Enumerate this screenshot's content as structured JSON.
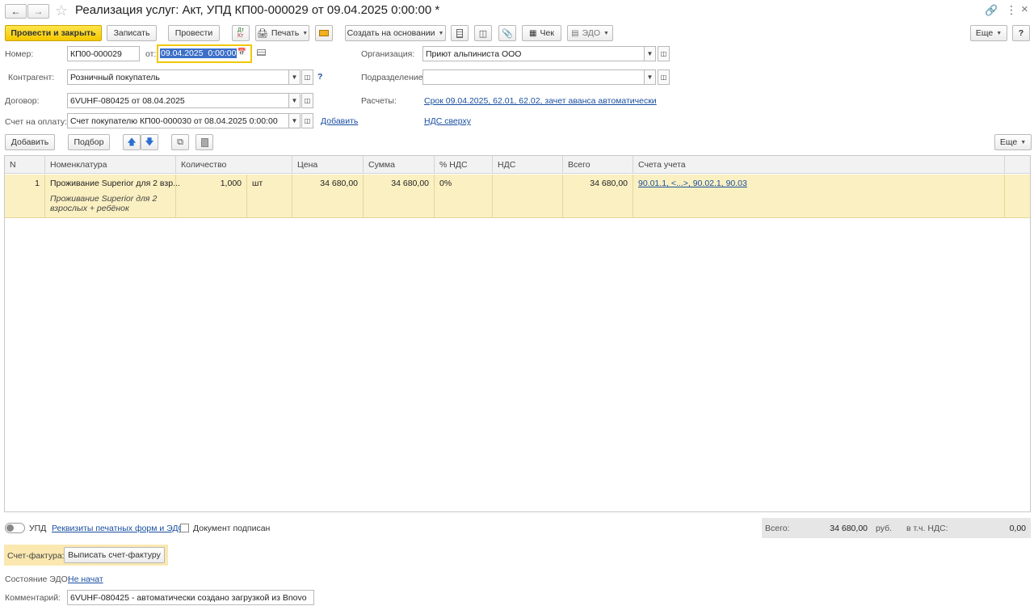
{
  "window": {
    "title": "Реализация услуг: Акт, УПД КП00-000029 от 09.04.2025 0:00:00 *"
  },
  "toolbar": {
    "post_close": "Провести и закрыть",
    "save": "Записать",
    "post": "Провести",
    "print": "Печать",
    "create_based": "Создать на основании",
    "check": "Чек",
    "edo": "ЭДО",
    "more": "Еще",
    "help": "?"
  },
  "header": {
    "number_label": "Номер:",
    "number_value": "КП00-000029",
    "date_label": "от:",
    "date_value": "09.04.2025  0:00:00",
    "org_label": "Организация:",
    "org_value": "Приют альпиниста ООО",
    "counterparty_label": "Контрагент:",
    "counterparty_value": "Розничный покупатель",
    "help_mark": "?",
    "division_label": "Подразделение:",
    "division_value": "",
    "contract_label": "Договор:",
    "contract_value": "6VUHF-080425 от 08.04.2025",
    "settlements_label": "Расчеты:",
    "settlements_link": "Срок 09.04.2025, 62.01, 62.02, зачет аванса автоматически",
    "invoice_label": "Счет на оплату:",
    "invoice_value": "Счет покупателю КП00-000030 от 08.04.2025 0:00:00",
    "add_link": "Добавить",
    "vat_link": "НДС сверху"
  },
  "table_toolbar": {
    "add": "Добавить",
    "pick": "Подбор",
    "more": "Еще"
  },
  "table": {
    "columns": [
      "N",
      "Номенклатура",
      "Количество",
      "Цена",
      "Сумма",
      "% НДС",
      "НДС",
      "Всего",
      "Счета учета"
    ],
    "rows": [
      {
        "n": "1",
        "item": "Проживание Superior для 2 взр...",
        "item_desc_1": "Проживание Superior для 2",
        "item_desc_2": "взрослых + ребёнок",
        "qty": "1,000",
        "unit": "шт",
        "price": "34 680,00",
        "sum": "34 680,00",
        "vat_rate": "0%",
        "vat": "",
        "total": "34 680,00",
        "accounts": "90.01.1, <...>, 90.02.1, 90.03"
      }
    ]
  },
  "footer": {
    "upd_label": "УПД",
    "print_forms_link": "Реквизиты печатных форм и ЭДО",
    "signed_label": "Документ подписан",
    "total_label": "Всего:",
    "total_value": "34 680,00",
    "currency": "руб.",
    "vat_incl_label": "в т.ч. НДС:",
    "vat_incl_value": "0,00",
    "invoice_label": "Счет-фактура:",
    "invoice_button": "Выписать счет-фактуру",
    "edo_state_label": "Состояние ЭДО:",
    "edo_state_link": "Не начат",
    "comment_label": "Комментарий:",
    "comment_value": "6VUHF-080425 - автоматически создано загрузкой из Bnovo"
  },
  "colors": {
    "primary_button": "#f5c800",
    "selected_row": "#fbf0c2",
    "link": "#1a4fa0",
    "invoice_panel": "#fbe8b0"
  }
}
